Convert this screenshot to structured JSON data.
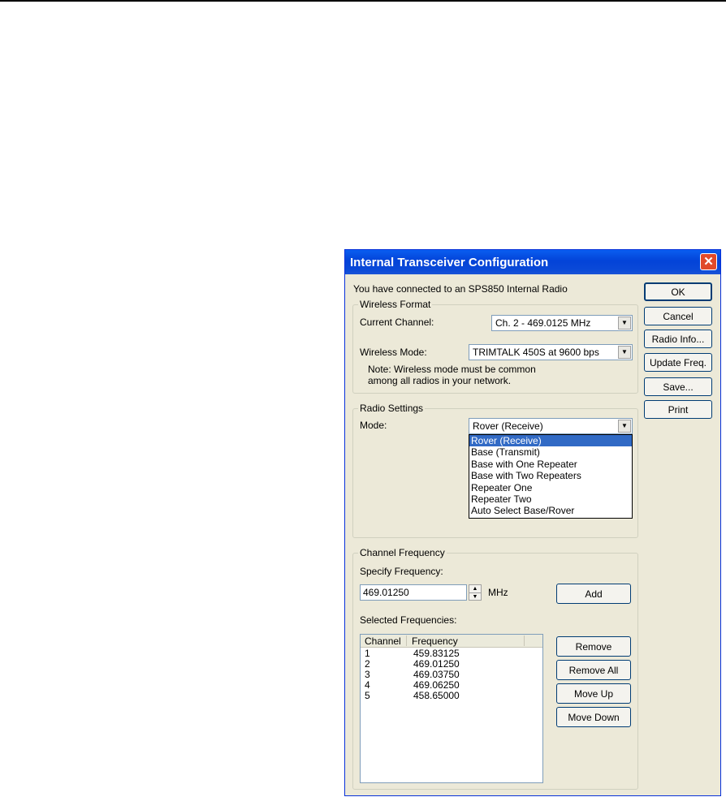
{
  "dialog": {
    "title": "Internal Transceiver Configuration",
    "close_glyph": "✕",
    "connection_text": "You have connected to an SPS850 Internal Radio"
  },
  "buttons": {
    "ok": "OK",
    "cancel": "Cancel",
    "radio_info": "Radio Info...",
    "update_freq": "Update Freq.",
    "save": "Save...",
    "print": "Print",
    "add": "Add",
    "remove": "Remove",
    "remove_all": "Remove All",
    "move_up": "Move Up",
    "move_down": "Move Down"
  },
  "wireless_format": {
    "legend": "Wireless Format",
    "current_channel_label": "Current Channel:",
    "current_channel_value": "Ch.  2 - 469.0125 MHz",
    "wireless_mode_label": "Wireless Mode:",
    "wireless_mode_value": "TRIMTALK 450S at 9600 bps",
    "note_line1": "Note: Wireless mode must be common",
    "note_line2": "among all radios in your network."
  },
  "radio_settings": {
    "legend": "Radio Settings",
    "mode_label": "Mode:",
    "mode_value": "Rover (Receive)",
    "mode_options": [
      "Rover (Receive)",
      "Base (Transmit)",
      "Base with One Repeater",
      "Base with Two Repeaters",
      "Repeater One",
      "Repeater Two",
      "Auto Select Base/Rover"
    ]
  },
  "channel_frequency": {
    "legend": "Channel Frequency",
    "specify_label": "Specify Frequency:",
    "frequency_value": "469.01250",
    "unit": "MHz",
    "selected_label": "Selected Frequencies:",
    "columns": [
      "Channel",
      "Frequency"
    ],
    "rows": [
      {
        "channel": "1",
        "frequency": "459.83125"
      },
      {
        "channel": "2",
        "frequency": "469.01250"
      },
      {
        "channel": "3",
        "frequency": "469.03750"
      },
      {
        "channel": "4",
        "frequency": "469.06250"
      },
      {
        "channel": "5",
        "frequency": "458.65000"
      }
    ]
  },
  "colors": {
    "titlebar": "#0343d8",
    "dialog_bg": "#ece9d8",
    "selection": "#316ac5",
    "close_button": "#e04a2a"
  }
}
